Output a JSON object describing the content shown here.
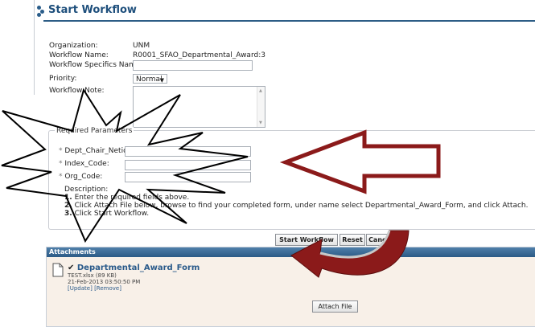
{
  "header": {
    "title": "Start Workflow"
  },
  "form": {
    "organization": {
      "label": "Organization:",
      "value": "UNM"
    },
    "workflow_name": {
      "label": "Workflow Name:",
      "value": "R0001_SFAO_Departmental_Award:3"
    },
    "specifics": {
      "label": "Workflow Specifics Name:",
      "value": ""
    },
    "priority": {
      "label": "Priority:",
      "value": "Normal"
    },
    "note": {
      "label": "Workflow Note:",
      "value": ""
    }
  },
  "required": {
    "title": "Required Parameters",
    "star": "*",
    "dept_chair": {
      "label": "Dept_Chair_Netid:",
      "value": ""
    },
    "index_code": {
      "label": "Index_Code:",
      "value": ""
    },
    "org_code": {
      "label": "Org_Code:",
      "value": ""
    },
    "description_label": "Description:",
    "steps": [
      {
        "num": "1.",
        "text": "Enter the required fields above."
      },
      {
        "num": "2.",
        "text": "Click Attach File below, browse to find your completed form, under name select Departmental_Award_Form, and click Attach."
      },
      {
        "num": "3.",
        "text": "Click Start Workflow."
      }
    ]
  },
  "buttons": {
    "start": "Start Workflow",
    "reset": "Reset",
    "cancel": "Cancel"
  },
  "attachments": {
    "title": "Attachments",
    "check": "✔",
    "name": "Departmental_Award_Form",
    "file": "TEST.xlsx (89 KB)",
    "date": "21-Feb-2013 03:50:50 PM",
    "update": "[Update]",
    "remove": "[Remove]",
    "attach_button": "Attach File"
  },
  "colors": {
    "header": "#1e4f7c",
    "attach_bar": "#2b5a86",
    "arrow": "#8b1a1a",
    "panel_bg": "#f8f0e8"
  },
  "icons": [
    "workflow-dots-icon",
    "dropdown-caret-icon",
    "document-icon",
    "checkmark-icon"
  ]
}
